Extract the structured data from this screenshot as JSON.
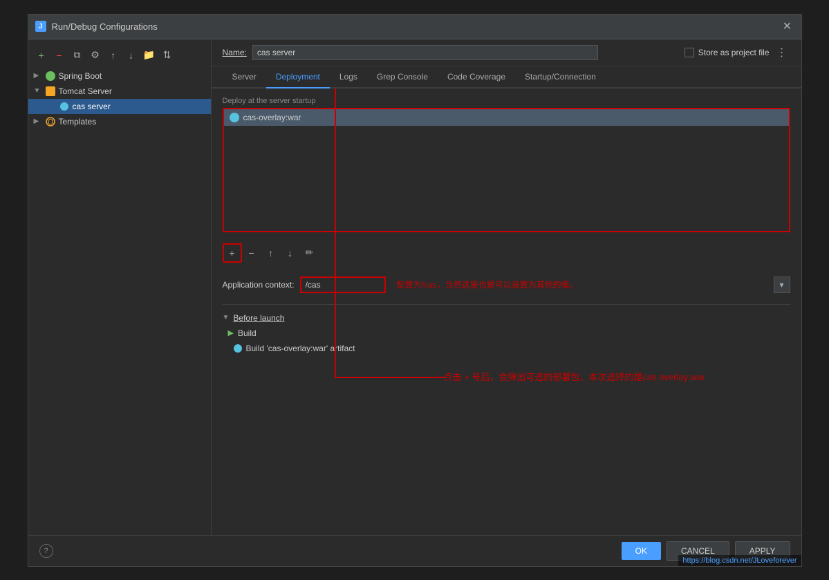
{
  "dialog": {
    "title": "Run/Debug Configurations",
    "title_icon": "J"
  },
  "name_field": {
    "label": "Name:",
    "value": "cas server"
  },
  "store_checkbox": {
    "label": "Store as project file"
  },
  "sidebar": {
    "toolbar": {
      "add": "+",
      "remove": "−",
      "copy": "⧉",
      "settings": "⚙",
      "up": "↑",
      "down": "↓",
      "folder": "📁",
      "sort": "⇅"
    },
    "tree": [
      {
        "label": "Spring Boot",
        "icon": "spring",
        "expanded": false,
        "indent": 0
      },
      {
        "label": "Tomcat Server",
        "icon": "tomcat",
        "expanded": true,
        "indent": 0
      },
      {
        "label": "cas server",
        "icon": "cas",
        "expanded": false,
        "indent": 1,
        "selected": true
      },
      {
        "label": "Templates",
        "icon": "gear",
        "expanded": false,
        "indent": 0
      }
    ]
  },
  "tabs": [
    {
      "label": "Server",
      "active": false
    },
    {
      "label": "Deployment",
      "active": true
    },
    {
      "label": "Logs",
      "active": false
    },
    {
      "label": "Grep Console",
      "active": false
    },
    {
      "label": "Code Coverage",
      "active": false
    },
    {
      "label": "Startup/Connection",
      "active": false
    }
  ],
  "deployment": {
    "section_label": "Deploy at the server startup",
    "deploy_item": "cas-overlay:war",
    "annotation_text": "点击 + 号后，会弹出可选的部署包，本次选择的是cas overlay:war",
    "context_label": "Application context:",
    "context_value": "/cas",
    "context_annotation": "配置为/cas，当然这里也是可以设置为其他的值。",
    "toolbar_buttons": [
      "+",
      "−",
      "↑",
      "↓",
      "✏"
    ]
  },
  "before_launch": {
    "label": "Before launch",
    "items": [
      {
        "label": "Build",
        "type": "arrow"
      },
      {
        "label": "Build 'cas-overlay:war' artifact",
        "type": "sub"
      }
    ]
  },
  "footer": {
    "ok": "OK",
    "cancel": "CANCEL",
    "apply": "APPLY",
    "watermark": "https://blog.csdn.net/JLoveforever"
  }
}
